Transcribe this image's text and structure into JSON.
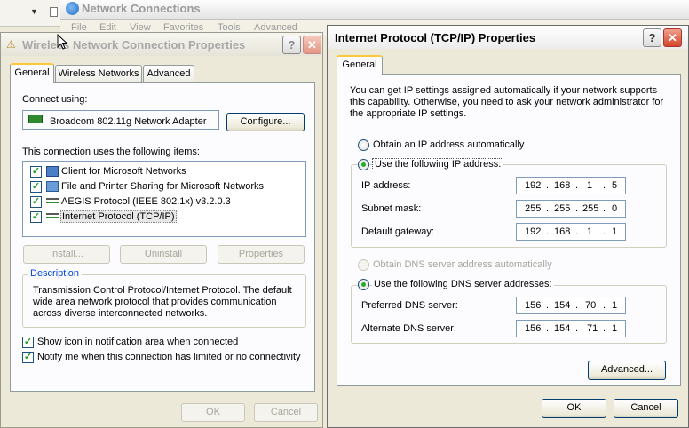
{
  "background": {
    "title": "Network Connections",
    "menu": [
      "File",
      "Edit",
      "View",
      "Favorites",
      "Tools",
      "Advanced"
    ]
  },
  "left_dialog": {
    "title": "Wireless Network Connection Properties",
    "help_btn": "?",
    "close_btn": "✕",
    "tabs": [
      "General",
      "Wireless Networks",
      "Advanced"
    ],
    "connect_using_label": "Connect using:",
    "adapter": "Broadcom 802.11g Network Adapter",
    "configure_btn": "Configure...",
    "items_label": "This connection uses the following items:",
    "items": [
      {
        "label": "Client for Microsoft Networks",
        "checked": true,
        "icon": "network-client-icon"
      },
      {
        "label": "File and Printer Sharing for Microsoft Networks",
        "checked": true,
        "icon": "file-sharing-icon"
      },
      {
        "label": "AEGIS Protocol (IEEE 802.1x) v3.2.0.3",
        "checked": true,
        "icon": "protocol-icon"
      },
      {
        "label": "Internet Protocol (TCP/IP)",
        "checked": true,
        "icon": "protocol-icon"
      }
    ],
    "install_btn": "Install...",
    "uninstall_btn": "Uninstall",
    "properties_btn": "Properties",
    "description_title": "Description",
    "description_text": "Transmission Control Protocol/Internet Protocol. The default wide area network protocol that provides communication across diverse interconnected networks.",
    "show_icon_label": "Show icon in notification area when connected",
    "notify_label": "Notify me when this connection has limited or no connectivity",
    "ok_btn": "OK",
    "cancel_btn": "Cancel"
  },
  "tcpip_dialog": {
    "title": "Internet Protocol (TCP/IP) Properties",
    "help_btn": "?",
    "close_btn": "✕",
    "tab": "General",
    "intro": "You can get IP settings assigned automatically if your network supports this capability. Otherwise, you need to ask your network administrator for the appropriate IP settings.",
    "obtain_ip_auto": "Obtain an IP address automatically",
    "use_following_ip": "Use the following IP address:",
    "ip_address_label": "IP address:",
    "ip_address": [
      "192",
      "168",
      "1",
      "5"
    ],
    "subnet_label": "Subnet mask:",
    "subnet": [
      "255",
      "255",
      "255",
      "0"
    ],
    "gateway_label": "Default gateway:",
    "gateway": [
      "192",
      "168",
      "1",
      "1"
    ],
    "obtain_dns_auto": "Obtain DNS server address automatically",
    "use_following_dns": "Use the following DNS server addresses:",
    "preferred_dns_label": "Preferred DNS server:",
    "preferred_dns": [
      "156",
      "154",
      "70",
      "1"
    ],
    "alternate_dns_label": "Alternate DNS server:",
    "alternate_dns": [
      "156",
      "154",
      "71",
      "1"
    ],
    "advanced_btn": "Advanced...",
    "ok_btn": "OK",
    "cancel_btn": "Cancel"
  }
}
